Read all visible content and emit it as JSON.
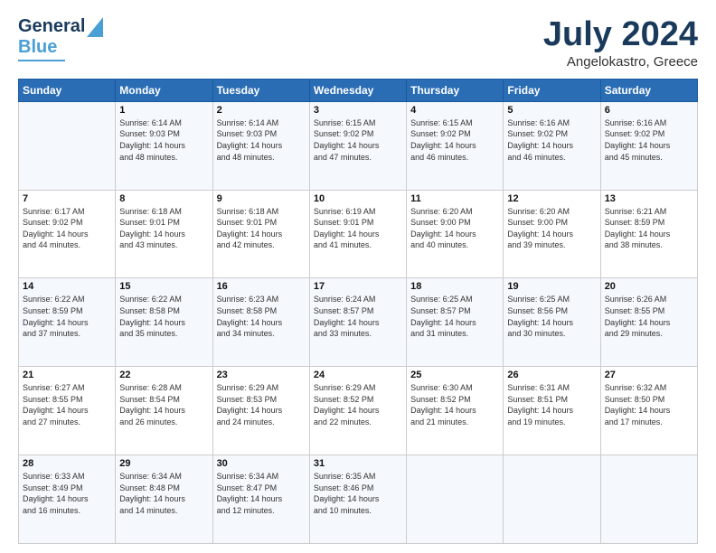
{
  "header": {
    "logo_line1": "General",
    "logo_line2": "Blue",
    "title": "July 2024",
    "subtitle": "Angelokastro, Greece"
  },
  "calendar": {
    "headers": [
      "Sunday",
      "Monday",
      "Tuesday",
      "Wednesday",
      "Thursday",
      "Friday",
      "Saturday"
    ],
    "weeks": [
      [
        {
          "day": "",
          "text": ""
        },
        {
          "day": "1",
          "text": "Sunrise: 6:14 AM\nSunset: 9:03 PM\nDaylight: 14 hours\nand 48 minutes."
        },
        {
          "day": "2",
          "text": "Sunrise: 6:14 AM\nSunset: 9:03 PM\nDaylight: 14 hours\nand 48 minutes."
        },
        {
          "day": "3",
          "text": "Sunrise: 6:15 AM\nSunset: 9:02 PM\nDaylight: 14 hours\nand 47 minutes."
        },
        {
          "day": "4",
          "text": "Sunrise: 6:15 AM\nSunset: 9:02 PM\nDaylight: 14 hours\nand 46 minutes."
        },
        {
          "day": "5",
          "text": "Sunrise: 6:16 AM\nSunset: 9:02 PM\nDaylight: 14 hours\nand 46 minutes."
        },
        {
          "day": "6",
          "text": "Sunrise: 6:16 AM\nSunset: 9:02 PM\nDaylight: 14 hours\nand 45 minutes."
        }
      ],
      [
        {
          "day": "7",
          "text": "Sunrise: 6:17 AM\nSunset: 9:02 PM\nDaylight: 14 hours\nand 44 minutes."
        },
        {
          "day": "8",
          "text": "Sunrise: 6:18 AM\nSunset: 9:01 PM\nDaylight: 14 hours\nand 43 minutes."
        },
        {
          "day": "9",
          "text": "Sunrise: 6:18 AM\nSunset: 9:01 PM\nDaylight: 14 hours\nand 42 minutes."
        },
        {
          "day": "10",
          "text": "Sunrise: 6:19 AM\nSunset: 9:01 PM\nDaylight: 14 hours\nand 41 minutes."
        },
        {
          "day": "11",
          "text": "Sunrise: 6:20 AM\nSunset: 9:00 PM\nDaylight: 14 hours\nand 40 minutes."
        },
        {
          "day": "12",
          "text": "Sunrise: 6:20 AM\nSunset: 9:00 PM\nDaylight: 14 hours\nand 39 minutes."
        },
        {
          "day": "13",
          "text": "Sunrise: 6:21 AM\nSunset: 8:59 PM\nDaylight: 14 hours\nand 38 minutes."
        }
      ],
      [
        {
          "day": "14",
          "text": "Sunrise: 6:22 AM\nSunset: 8:59 PM\nDaylight: 14 hours\nand 37 minutes."
        },
        {
          "day": "15",
          "text": "Sunrise: 6:22 AM\nSunset: 8:58 PM\nDaylight: 14 hours\nand 35 minutes."
        },
        {
          "day": "16",
          "text": "Sunrise: 6:23 AM\nSunset: 8:58 PM\nDaylight: 14 hours\nand 34 minutes."
        },
        {
          "day": "17",
          "text": "Sunrise: 6:24 AM\nSunset: 8:57 PM\nDaylight: 14 hours\nand 33 minutes."
        },
        {
          "day": "18",
          "text": "Sunrise: 6:25 AM\nSunset: 8:57 PM\nDaylight: 14 hours\nand 31 minutes."
        },
        {
          "day": "19",
          "text": "Sunrise: 6:25 AM\nSunset: 8:56 PM\nDaylight: 14 hours\nand 30 minutes."
        },
        {
          "day": "20",
          "text": "Sunrise: 6:26 AM\nSunset: 8:55 PM\nDaylight: 14 hours\nand 29 minutes."
        }
      ],
      [
        {
          "day": "21",
          "text": "Sunrise: 6:27 AM\nSunset: 8:55 PM\nDaylight: 14 hours\nand 27 minutes."
        },
        {
          "day": "22",
          "text": "Sunrise: 6:28 AM\nSunset: 8:54 PM\nDaylight: 14 hours\nand 26 minutes."
        },
        {
          "day": "23",
          "text": "Sunrise: 6:29 AM\nSunset: 8:53 PM\nDaylight: 14 hours\nand 24 minutes."
        },
        {
          "day": "24",
          "text": "Sunrise: 6:29 AM\nSunset: 8:52 PM\nDaylight: 14 hours\nand 22 minutes."
        },
        {
          "day": "25",
          "text": "Sunrise: 6:30 AM\nSunset: 8:52 PM\nDaylight: 14 hours\nand 21 minutes."
        },
        {
          "day": "26",
          "text": "Sunrise: 6:31 AM\nSunset: 8:51 PM\nDaylight: 14 hours\nand 19 minutes."
        },
        {
          "day": "27",
          "text": "Sunrise: 6:32 AM\nSunset: 8:50 PM\nDaylight: 14 hours\nand 17 minutes."
        }
      ],
      [
        {
          "day": "28",
          "text": "Sunrise: 6:33 AM\nSunset: 8:49 PM\nDaylight: 14 hours\nand 16 minutes."
        },
        {
          "day": "29",
          "text": "Sunrise: 6:34 AM\nSunset: 8:48 PM\nDaylight: 14 hours\nand 14 minutes."
        },
        {
          "day": "30",
          "text": "Sunrise: 6:34 AM\nSunset: 8:47 PM\nDaylight: 14 hours\nand 12 minutes."
        },
        {
          "day": "31",
          "text": "Sunrise: 6:35 AM\nSunset: 8:46 PM\nDaylight: 14 hours\nand 10 minutes."
        },
        {
          "day": "",
          "text": ""
        },
        {
          "day": "",
          "text": ""
        },
        {
          "day": "",
          "text": ""
        }
      ]
    ]
  }
}
